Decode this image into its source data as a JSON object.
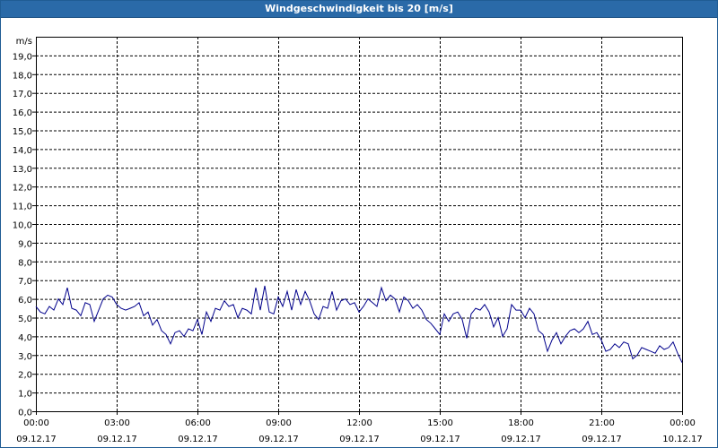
{
  "window": {
    "title": "Windgeschwindigkeit bis 20 [m/s]"
  },
  "chart_data": {
    "type": "line",
    "title": "Windgeschwindigkeit bis 20 [m/s]",
    "ylabel": "m/s",
    "ylim": [
      0,
      20
    ],
    "y_ticks": [
      "0,0",
      "1,0",
      "2,0",
      "3,0",
      "4,0",
      "5,0",
      "6,0",
      "7,0",
      "8,0",
      "9,0",
      "10,0",
      "11,0",
      "12,0",
      "13,0",
      "14,0",
      "15,0",
      "16,0",
      "17,0",
      "18,0",
      "19,0"
    ],
    "x_ticks": [
      {
        "time": "00:00",
        "date": "09.12.17"
      },
      {
        "time": "03:00",
        "date": "09.12.17"
      },
      {
        "time": "06:00",
        "date": "09.12.17"
      },
      {
        "time": "09:00",
        "date": "09.12.17"
      },
      {
        "time": "12:00",
        "date": "09.12.17"
      },
      {
        "time": "15:00",
        "date": "09.12.17"
      },
      {
        "time": "18:00",
        "date": "09.12.17"
      },
      {
        "time": "21:00",
        "date": "09.12.17"
      },
      {
        "time": "00:00",
        "date": "10.12.17"
      }
    ],
    "xlim_hours": [
      0,
      24
    ],
    "grid": true,
    "line_color": "#00008b",
    "series": [
      {
        "x_hours": [
          0,
          0.167,
          0.333,
          0.5,
          0.667,
          0.833,
          1,
          1.167,
          1.333,
          1.5,
          1.667,
          1.833,
          2,
          2.167,
          2.333,
          2.5,
          2.667,
          2.833,
          3,
          3.167,
          3.333,
          3.5,
          3.667,
          3.833,
          4,
          4.167,
          4.333,
          4.5,
          4.667,
          4.833,
          5,
          5.167,
          5.333,
          5.5,
          5.667,
          5.833,
          6,
          6.167,
          6.333,
          6.5,
          6.667,
          6.833,
          7,
          7.167,
          7.333,
          7.5,
          7.667,
          7.833,
          8,
          8.167,
          8.333,
          8.5,
          8.667,
          8.833,
          9,
          9.167,
          9.333,
          9.5,
          9.667,
          9.833,
          10,
          10.167,
          10.333,
          10.5,
          10.667,
          10.833,
          11,
          11.167,
          11.333,
          11.5,
          11.667,
          11.833,
          12,
          12.167,
          12.333,
          12.5,
          12.667,
          12.833,
          13,
          13.167,
          13.333,
          13.5,
          13.667,
          13.833,
          14,
          14.167,
          14.333,
          14.5,
          14.667,
          14.833,
          15,
          15.167,
          15.333,
          15.5,
          15.667,
          15.833,
          16,
          16.167,
          16.333,
          16.5,
          16.667,
          16.833,
          17,
          17.167,
          17.333,
          17.5,
          17.667,
          17.833,
          18,
          18.167,
          18.333,
          18.5,
          18.667,
          18.833,
          19,
          19.167,
          19.333,
          19.5,
          19.667,
          19.833,
          20,
          20.167,
          20.333,
          20.5,
          20.667,
          20.833,
          21,
          21.167,
          21.333,
          21.5,
          21.667,
          21.833,
          22,
          22.167,
          22.333,
          22.5,
          22.667,
          22.833,
          23,
          23.167,
          23.333,
          23.5,
          23.667,
          23.833,
          24
        ],
        "values": [
          5.6,
          5.3,
          5.2,
          5.6,
          5.4,
          6.0,
          5.7,
          6.6,
          5.5,
          5.4,
          5.1,
          5.8,
          5.7,
          4.8,
          5.4,
          6.0,
          6.2,
          6.1,
          5.7,
          5.5,
          5.4,
          5.5,
          5.6,
          5.8,
          5.1,
          5.3,
          4.6,
          4.9,
          4.3,
          4.1,
          3.6,
          4.2,
          4.3,
          4.0,
          4.4,
          4.3,
          4.9,
          4.1,
          5.3,
          4.8,
          5.5,
          5.4,
          5.9,
          5.6,
          5.7,
          5.0,
          5.5,
          5.4,
          5.2,
          6.6,
          5.4,
          6.7,
          5.3,
          5.2,
          6.1,
          5.6,
          6.4,
          5.4,
          6.5,
          5.7,
          6.4,
          5.9,
          5.2,
          4.9,
          5.6,
          5.5,
          6.4,
          5.4,
          5.9,
          6.0,
          5.7,
          5.8,
          5.3,
          5.6,
          6.0,
          5.8,
          5.6,
          6.6,
          5.9,
          6.2,
          6.0,
          5.3,
          6.1,
          5.9,
          5.5,
          5.7,
          5.4,
          4.9,
          4.7,
          4.4,
          4.1,
          5.2,
          4.8,
          5.2,
          5.3,
          4.9,
          3.9,
          5.2,
          5.5,
          5.4,
          5.7,
          5.3,
          4.5,
          5.0,
          4.0,
          4.4,
          5.7,
          5.4,
          5.4,
          5.0,
          5.5,
          5.2,
          4.3,
          4.1,
          3.2,
          3.8,
          4.2,
          3.6,
          4.0,
          4.3,
          4.4,
          4.2,
          4.4,
          4.8,
          4.1,
          4.2,
          3.8,
          3.2,
          3.3,
          3.6,
          3.4,
          3.7,
          3.6,
          2.8,
          3.0,
          3.4,
          3.3,
          3.2,
          3.1,
          3.5,
          3.3,
          3.4,
          3.7,
          3.1,
          2.6,
          2.8,
          2.9
        ]
      }
    ]
  }
}
